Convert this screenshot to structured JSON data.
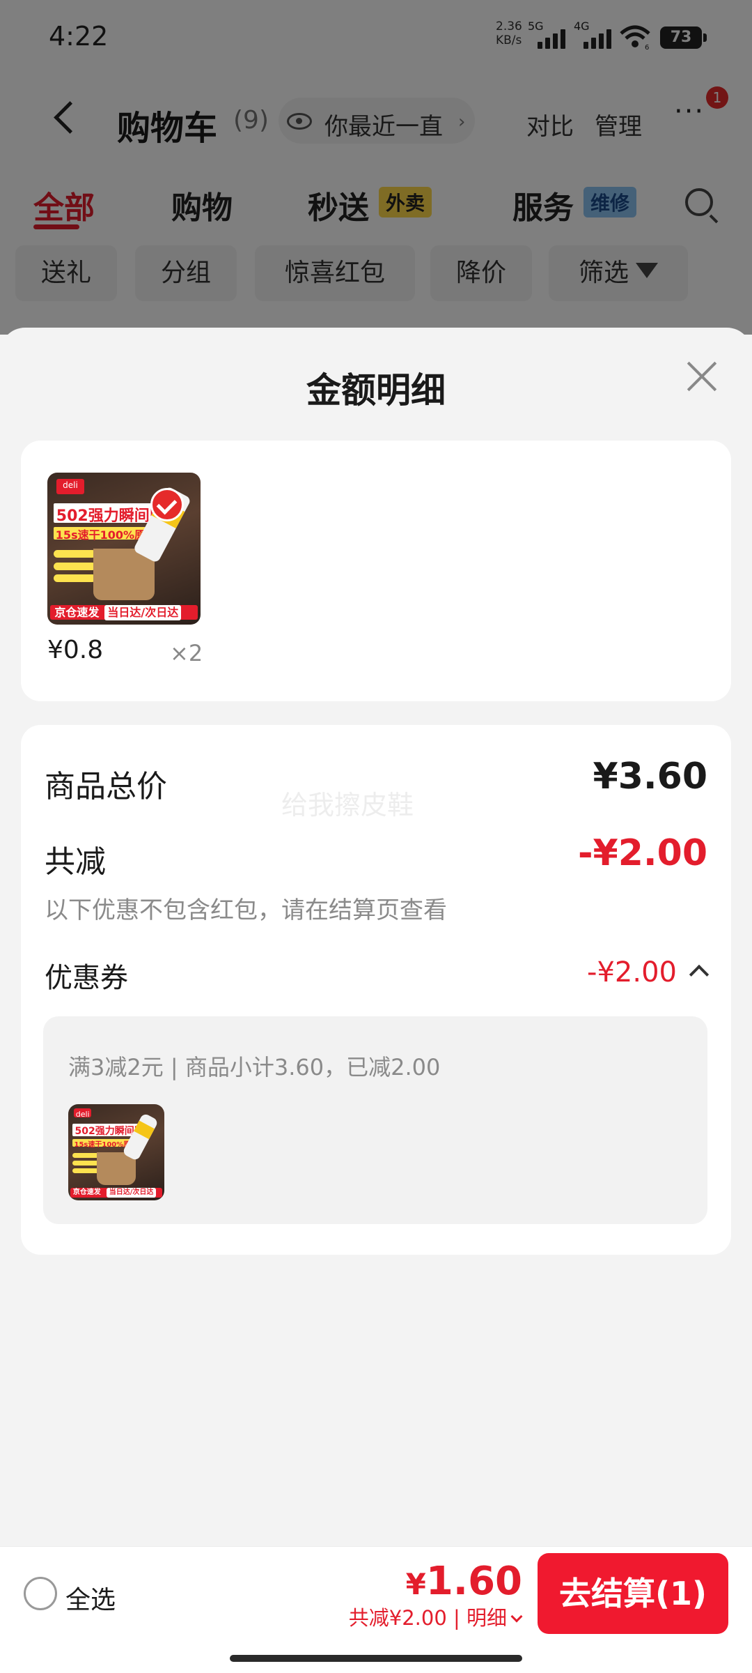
{
  "status_bar": {
    "time": "4:22",
    "net_speed_value": "2.36",
    "net_speed_unit": "KB/s",
    "signal_1": "5G",
    "signal_2": "4G",
    "wifi_sub": "6",
    "battery": "73"
  },
  "nav": {
    "title": "购物车",
    "count": "(9)",
    "recent_label": "你最近一直",
    "compare": "对比",
    "manage": "管理",
    "more": "···",
    "badge": "1",
    "icons": [
      "back-icon",
      "eye-icon",
      "chevron-right-icon",
      "more-icon"
    ]
  },
  "tabs": [
    {
      "label": "全部",
      "active": true
    },
    {
      "label": "购物"
    },
    {
      "label": "秒送",
      "tag": "外卖"
    },
    {
      "label": "服务",
      "tag": "维修"
    }
  ],
  "filter_chips": [
    "送礼",
    "分组",
    "惊喜红包",
    "降价",
    "筛选"
  ],
  "sheet": {
    "title": "金额明细",
    "watermark": "给我擦皮鞋"
  },
  "product": {
    "unit_price": "¥0.8",
    "quantity": "×2",
    "thumb": {
      "brand": "deli",
      "headline": "502强力瞬间胶",
      "subline": "15s速干100%原胶",
      "footer_left": "京仓速发",
      "footer_right": "当日达/次日达"
    }
  },
  "summary": {
    "total_label": "商品总价",
    "total_value": "¥3.60",
    "reduce_label": "共减",
    "reduce_value": "-¥2.00",
    "note": "以下优惠不包含红包，请在结算页查看",
    "coupon_label": "优惠券",
    "coupon_value": "-¥2.00",
    "coupon_desc": "满3减2元 | 商品小计3.60，已减2.00"
  },
  "bottom_bar": {
    "select_all": "全选",
    "price_symbol": "¥",
    "price": "1.60",
    "saving": "共减¥2.00 | 明细",
    "checkout": "去结算(1)"
  },
  "colors": {
    "accent_red": "#e31d2c",
    "checkout_red": "#f0192f",
    "tag_takeout": "#ffd84a",
    "tag_repair": "#8bc2f0"
  }
}
